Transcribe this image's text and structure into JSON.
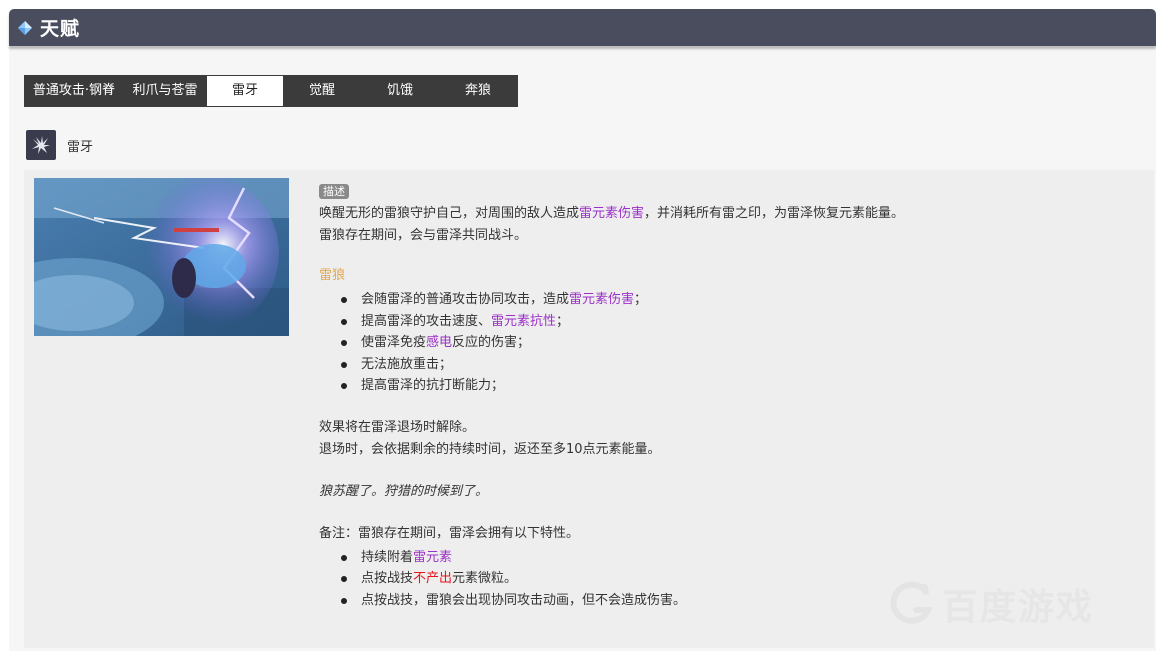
{
  "header": {
    "title": "天赋",
    "accent": "#4a4d5e"
  },
  "tabs": [
    {
      "label": "普通攻击·钢脊",
      "active": false
    },
    {
      "label": "利爪与苍雷",
      "active": false
    },
    {
      "label": "雷牙",
      "active": true
    },
    {
      "label": "觉醒",
      "active": false
    },
    {
      "label": "饥饿",
      "active": false
    },
    {
      "label": "奔狼",
      "active": false
    }
  ],
  "skill": {
    "name": "雷牙",
    "icon": "wolf-claw-icon"
  },
  "content": {
    "badge": "描述",
    "desc1_a": "唤醒无形的雷狼守护自己，对周围的敌人造成",
    "desc1_b": "雷元素伤害",
    "desc1_c": "，并消耗所有雷之印，为雷泽恢复元素能量。",
    "desc2": "雷狼存在期间，会与雷泽共同战斗。",
    "subtitle": "雷狼",
    "bullets1": {
      "b1_a": "会随雷泽的普通攻击协同攻击，造成",
      "b1_b": "雷元素伤害",
      "b1_c": "；",
      "b2_a": "提高雷泽的攻击速度、",
      "b2_b": "雷元素抗性",
      "b2_c": "；",
      "b3_a": "使雷泽免疫",
      "b3_b": "感电",
      "b3_c": "反应的伤害；",
      "b4": "无法施放重击；",
      "b5": "提高雷泽的抗打断能力；"
    },
    "end1": "效果将在雷泽退场时解除。",
    "end2": "退场时，会依据剩余的持续时间，返还至多10点元素能量。",
    "quote": "狼苏醒了。狩猎的时候到了。",
    "note": "备注：雷狼存在期间，雷泽会拥有以下特性。",
    "bullets2": {
      "n1_a": "持续附着",
      "n1_b": "雷元素",
      "n2_a": "点按战技",
      "n2_b": "不产出",
      "n2_c": "元素微粒。",
      "n3": "点按战技，雷狼会出现协同攻击动画，但不会造成伤害。"
    }
  },
  "colors": {
    "electro": "#9b30c8",
    "warning": "#e8141c",
    "subtitle": "#e0a752"
  },
  "watermark": {
    "text": "百度游戏"
  }
}
